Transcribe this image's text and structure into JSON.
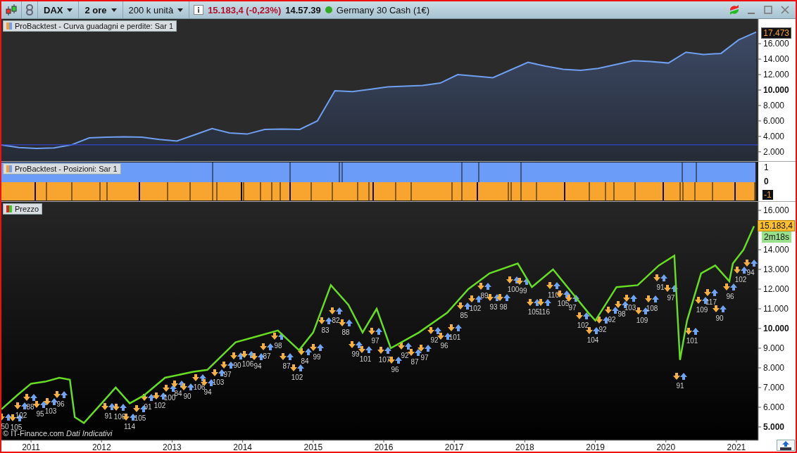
{
  "toolbar": {
    "dropdowns": [
      {
        "label": "DAX",
        "bold": true
      },
      {
        "label": "2 ore",
        "bold": true
      },
      {
        "label": "200 k unità",
        "bold": false
      }
    ],
    "quote": {
      "price": "15.183,4 (-0,23%)",
      "time": "14.57.39",
      "instrument": "Germany 30 Cash (1€)"
    }
  },
  "equity_panel": {
    "last_value": "17.473",
    "chart_data": {
      "type": "area",
      "categories": [
        null,
        null,
        null,
        null,
        null,
        null,
        null,
        null,
        null,
        null,
        null,
        null,
        null,
        null,
        null,
        null,
        null,
        null,
        null,
        null,
        null,
        null,
        null,
        null,
        null,
        null,
        null,
        null,
        null,
        null,
        null,
        null,
        null,
        null,
        null,
        null,
        null,
        null,
        null,
        null,
        null,
        null,
        null,
        null
      ],
      "series": [
        {
          "name": "ProBacktest - Curva guadagni e perdite: Sar 1",
          "color": "#6f9ff0",
          "values": [
            2900,
            2550,
            2450,
            2500,
            2900,
            3800,
            3900,
            3950,
            3900,
            3600,
            3400,
            4200,
            5000,
            4450,
            4300,
            4900,
            4950,
            4900,
            6000,
            9900,
            9800,
            10100,
            10400,
            10500,
            10600,
            10900,
            12000,
            11800,
            11600,
            12600,
            13600,
            13100,
            12700,
            12550,
            12800,
            13300,
            13800,
            13700,
            13500,
            14900,
            14600,
            14750,
            16500,
            17500
          ]
        }
      ],
      "ylim": [
        800,
        19200
      ],
      "yticks": [
        {
          "value": 2000,
          "label": "2.000"
        },
        {
          "value": 4000,
          "label": "4.000"
        },
        {
          "value": 6000,
          "label": "6.000"
        },
        {
          "value": 8000,
          "label": "8.000"
        },
        {
          "value": 10000,
          "label": "10.000"
        },
        {
          "value": 12000,
          "label": "12.000"
        },
        {
          "value": 14000,
          "label": "14.000"
        },
        {
          "value": 16000,
          "label": "16.000"
        }
      ],
      "ref_lines": [
        {
          "axis": "y",
          "value": 2900
        }
      ]
    }
  },
  "positions_panel": {
    "legend": "ProBacktest - Posizioni: Sar 1",
    "ticks": [
      {
        "label": "1",
        "major": false,
        "boxed": false
      },
      {
        "label": "0",
        "major": true,
        "boxed": false
      },
      {
        "label": "-1",
        "major": false,
        "boxed": true
      }
    ]
  },
  "price_panel": {
    "source_note": "© IT-Finance.com  *Dati Indicativi*",
    "last_price": "15.183,4",
    "countdown": "2m18s",
    "trades": [
      "50",
      "105",
      "102",
      "88",
      "95",
      "103",
      "96",
      "91",
      "106",
      "114",
      "105",
      "91",
      "102",
      "100",
      "84",
      "90",
      "106",
      "94",
      "103",
      "97",
      "90",
      "106",
      "94",
      "87",
      "98",
      "87",
      "102",
      "84",
      "99",
      "83",
      "82",
      "88",
      "99",
      "101",
      "97",
      "107",
      "96",
      "92",
      "87",
      "97",
      "92",
      "96",
      "101",
      "85",
      "102",
      "89",
      "93",
      "98",
      "100",
      "99",
      "105",
      "116",
      "110",
      "105",
      "97",
      "102",
      "104",
      "92",
      "92",
      "98",
      "103",
      "109",
      "108",
      "91",
      "97",
      "91",
      "101",
      "109",
      "117",
      "90",
      "96",
      "102",
      "94"
    ],
    "chart_data": {
      "type": "line",
      "x": [
        2010.58,
        2010.8,
        2011.0,
        2011.2,
        2011.4,
        2011.55,
        2011.62,
        2011.75,
        2012.0,
        2012.2,
        2012.4,
        2012.6,
        2012.9,
        2013.3,
        2013.5,
        2013.9,
        2014.2,
        2014.5,
        2014.8,
        2015.0,
        2015.25,
        2015.5,
        2015.7,
        2015.9,
        2016.1,
        2016.5,
        2016.9,
        2017.2,
        2017.5,
        2017.9,
        2018.1,
        2018.4,
        2018.9,
        2019.0,
        2019.3,
        2019.6,
        2019.9,
        2020.12,
        2020.2,
        2020.3,
        2020.5,
        2020.7,
        2020.9,
        2020.95,
        2021.1,
        2021.25
      ],
      "series": [
        {
          "name": "Prezzo",
          "color": "#66dd22",
          "values": [
            5900,
            6600,
            7200,
            7300,
            7500,
            7400,
            5500,
            5200,
            6200,
            7000,
            6200,
            6600,
            7500,
            7800,
            7900,
            9300,
            9600,
            9900,
            8900,
            9800,
            12200,
            11200,
            9800,
            11000,
            9000,
            9800,
            10800,
            12000,
            12800,
            13300,
            12100,
            13000,
            10800,
            10400,
            12100,
            12200,
            13200,
            13700,
            8400,
            10400,
            12800,
            13200,
            12400,
            13300,
            14000,
            15200
          ]
        }
      ],
      "xlim": [
        2010.58,
        2021.31
      ],
      "ylim": [
        4320,
        16430
      ],
      "xticks": [
        {
          "value": 2011,
          "label": "2011"
        },
        {
          "value": 2012,
          "label": "2012"
        },
        {
          "value": 2013,
          "label": "2013"
        },
        {
          "value": 2014,
          "label": "2014"
        },
        {
          "value": 2015,
          "label": "2015"
        },
        {
          "value": 2016,
          "label": "2016"
        },
        {
          "value": 2017,
          "label": "2017"
        },
        {
          "value": 2018,
          "label": "2018"
        },
        {
          "value": 2019,
          "label": "2019"
        },
        {
          "value": 2020,
          "label": "2020"
        },
        {
          "value": 2021,
          "label": "2021"
        }
      ],
      "yticks": [
        {
          "value": 5000,
          "label": "5.000"
        },
        {
          "value": 6000,
          "label": "6.000"
        },
        {
          "value": 7000,
          "label": "7.000"
        },
        {
          "value": 8000,
          "label": "8.000"
        },
        {
          "value": 9000,
          "label": "9.000"
        },
        {
          "value": 10000,
          "label": "10.000"
        },
        {
          "value": 11000,
          "label": "11.000"
        },
        {
          "value": 12000,
          "label": "12.000"
        },
        {
          "value": 13000,
          "label": "13.000"
        },
        {
          "value": 14000,
          "label": "14.000"
        },
        {
          "value": 16000,
          "label": "16.000"
        }
      ]
    }
  }
}
